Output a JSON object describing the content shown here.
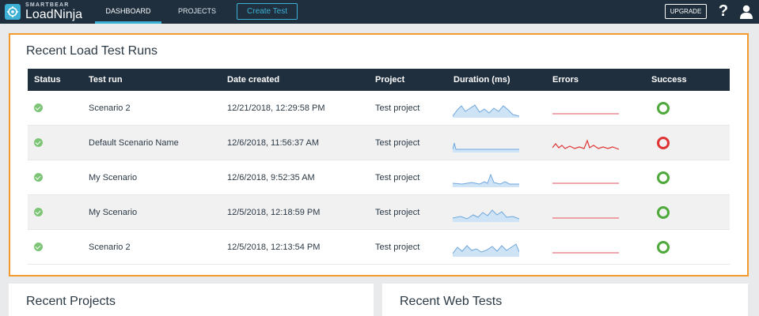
{
  "brand": {
    "company": "SMARTBEAR",
    "product": "LoadNinja"
  },
  "nav": {
    "dashboard": "DASHBOARD",
    "projects": "PROJECTS"
  },
  "actions": {
    "create_test": "Create Test",
    "upgrade": "UPGRADE",
    "help": "?"
  },
  "colors": {
    "accent": "#3db0d6",
    "header_bg": "#1f2f3e",
    "highlight": "#f29a2e",
    "success": "#4ea93b",
    "failure": "#e03434"
  },
  "runs": {
    "title": "Recent Load Test Runs",
    "columns": [
      "Status",
      "Test run",
      "Date created",
      "Project",
      "Duration (ms)",
      "Errors",
      "Success"
    ],
    "rows": [
      {
        "name": "Scenario 2",
        "date": "12/21/2018, 12:29:58 PM",
        "project": "Test project",
        "success": true
      },
      {
        "name": "Default Scenario Name",
        "date": "12/6/2018, 11:56:37 AM",
        "project": "Test project",
        "success": false
      },
      {
        "name": "My Scenario",
        "date": "12/6/2018, 9:52:35 AM",
        "project": "Test project",
        "success": true
      },
      {
        "name": "My Scenario",
        "date": "12/5/2018, 12:18:59 PM",
        "project": "Test project",
        "success": true
      },
      {
        "name": "Scenario 2",
        "date": "12/5/2018, 12:13:54 PM",
        "project": "Test project",
        "success": true
      }
    ]
  },
  "projects": {
    "title": "Recent Projects"
  },
  "web_tests": {
    "title": "Recent Web Tests"
  }
}
